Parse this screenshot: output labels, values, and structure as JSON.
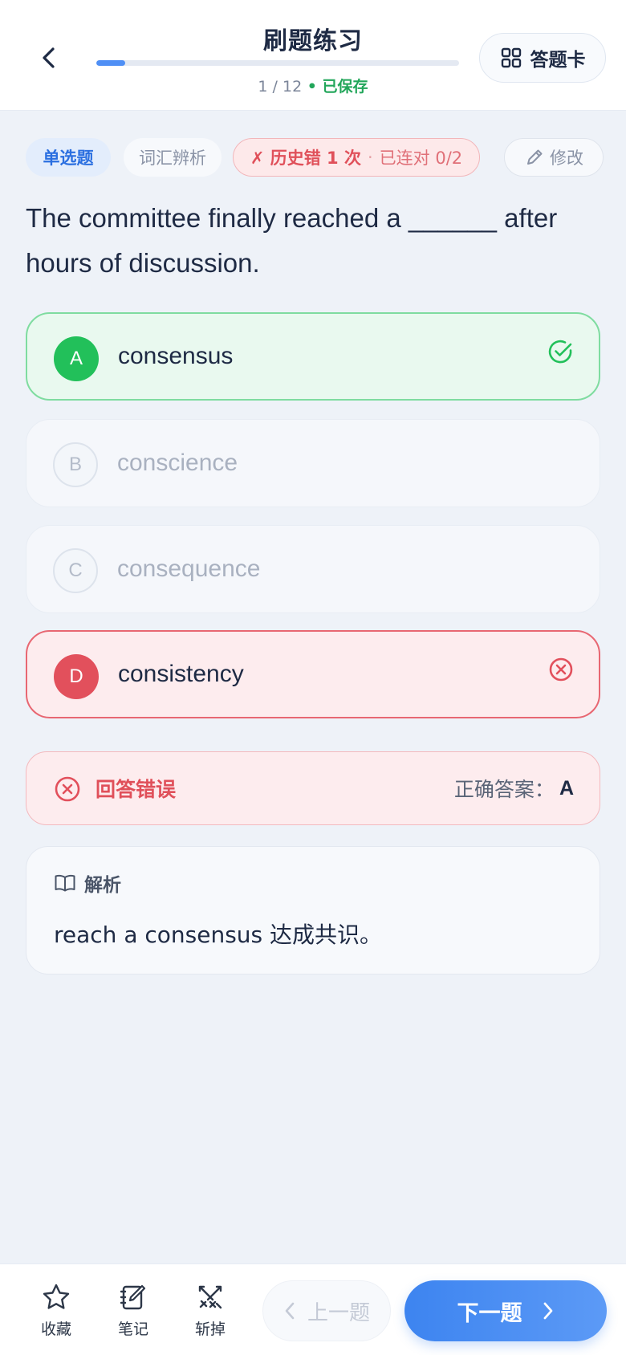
{
  "header": {
    "title": "刷题练习",
    "progress_current": 1,
    "progress_total": 12,
    "progress_sep": " / ",
    "progress_fraction": 0.08,
    "saved_label": " • 已保存",
    "card_label": "答题卡"
  },
  "tags": {
    "type": "单选题",
    "category": "词汇辨析",
    "history_wrong": "✗ 历史错 1 次",
    "history_dot": "·",
    "history_streak": "已连对 0/2",
    "edit_label": "修改"
  },
  "question": {
    "text": "The committee finally reached a ______ after hours of discussion."
  },
  "options": [
    {
      "letter": "A",
      "text": "consensus",
      "state": "correct"
    },
    {
      "letter": "B",
      "text": "conscience",
      "state": "plain"
    },
    {
      "letter": "C",
      "text": "consequence",
      "state": "plain"
    },
    {
      "letter": "D",
      "text": "consistency",
      "state": "wrong"
    }
  ],
  "result": {
    "label": "回答错误",
    "answer_label": "正确答案：",
    "answer_value": "A"
  },
  "analysis": {
    "title": "解析",
    "body": "reach a consensus 达成共识。"
  },
  "bottom": {
    "favorite": "收藏",
    "note": "笔记",
    "remove": "斩掉",
    "prev": "上一题",
    "next": "下一题"
  },
  "colors": {
    "accent": "#4f8ff5",
    "correct": "#22c05a",
    "wrong": "#e2505c"
  }
}
